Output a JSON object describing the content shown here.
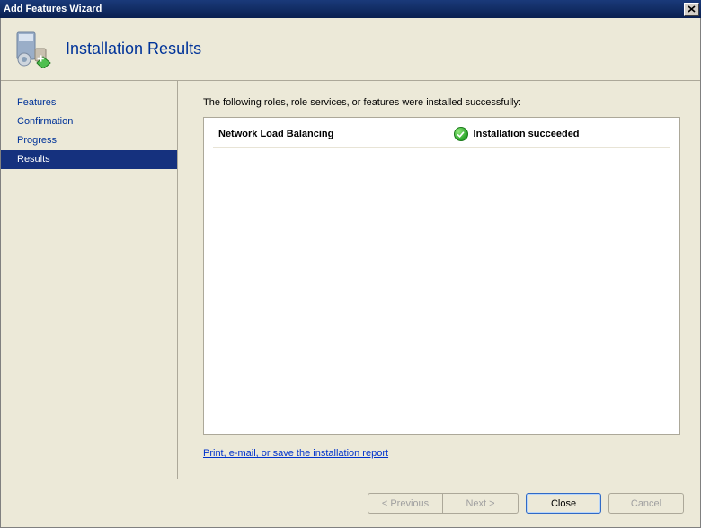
{
  "window": {
    "title": "Add Features Wizard"
  },
  "header": {
    "title": "Installation Results"
  },
  "sidebar": {
    "items": [
      {
        "label": "Features",
        "key": "features"
      },
      {
        "label": "Confirmation",
        "key": "confirmation"
      },
      {
        "label": "Progress",
        "key": "progress"
      },
      {
        "label": "Results",
        "key": "results",
        "active": true
      }
    ]
  },
  "main": {
    "intro": "The following roles, role services, or features were installed successfully:",
    "results": [
      {
        "feature": "Network Load Balancing",
        "status": "Installation succeeded",
        "icon": "success"
      }
    ],
    "report_link": "Print, e-mail, or save the installation report"
  },
  "buttons": {
    "previous": "< Previous",
    "next": "Next >",
    "close": "Close",
    "cancel": "Cancel"
  }
}
